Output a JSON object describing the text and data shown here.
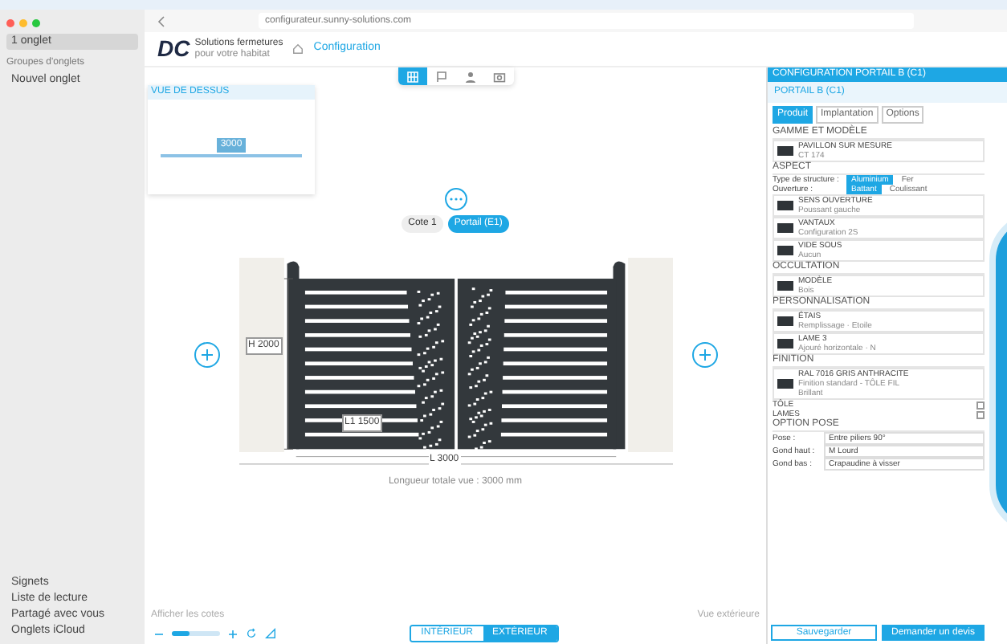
{
  "browser": {
    "url": "configurateur.sunny-solutions.com",
    "tabs": [
      {
        "label": "1 onglet",
        "selected": true
      }
    ],
    "group_heading": "Groupes d'onglets",
    "groups": [
      {
        "label": "Nouvel onglet"
      }
    ],
    "bottom_items": [
      {
        "label": "Signets"
      },
      {
        "label": "Liste de lecture"
      },
      {
        "label": "Partagé avec vous"
      },
      {
        "label": "Onglets iCloud"
      }
    ]
  },
  "header": {
    "logo": "DC",
    "brand_line1": "Solutions fermetures",
    "brand_line2": "pour votre habitat",
    "breadcrumb": "Configuration"
  },
  "view_tabs": [
    {
      "kind": "grid",
      "selected": true
    },
    {
      "kind": "plan",
      "selected": false
    },
    {
      "kind": "person",
      "selected": false
    },
    {
      "kind": "camera",
      "selected": false
    }
  ],
  "top_view": {
    "title": "VUE DE DESSUS",
    "width_label": "3000"
  },
  "scene": {
    "crumbs": [
      {
        "label": "Cote 1",
        "selected": false
      },
      {
        "label": "Portail (E1)",
        "selected": true
      }
    ],
    "height_label": "H 2000",
    "leaf_label": "L1 1500",
    "width_label": "L 3000",
    "total_label": "Longueur totale vue : 3000 mm"
  },
  "bottom_bar": {
    "left_hint": "Afficher les cotes",
    "right_hint": "Vue extérieure",
    "zoom": {
      "level": 0.35
    },
    "views": [
      {
        "label": "INTÉRIEUR",
        "selected": false
      },
      {
        "label": "EXTÉRIEUR",
        "selected": true
      }
    ]
  },
  "panel": {
    "title": "CONFIGURATION PORTAIL B (C1)",
    "subtitle": "PORTAIL B (C1)",
    "tabs": [
      {
        "label": "Produit",
        "selected": true
      },
      {
        "label": "Implantation",
        "selected": false
      },
      {
        "label": "Options",
        "selected": false
      }
    ],
    "sections": [
      {
        "title": "GAMME ET MODÈLE",
        "rows": [
          {
            "kind": "card",
            "name": "PAVILLON SUR MESURE",
            "detail": "CT 174"
          }
        ]
      },
      {
        "title": "ASPECT",
        "rows": [
          {
            "kind": "choice",
            "label": "Type de structure :",
            "options": [
              {
                "label": "Aluminium",
                "selected": true
              },
              {
                "label": "Fer",
                "selected": false
              }
            ]
          },
          {
            "kind": "choice",
            "label": "Ouverture :",
            "options": [
              {
                "label": "Battant",
                "selected": true
              },
              {
                "label": "Coulissant",
                "selected": false
              }
            ]
          },
          {
            "kind": "card",
            "name": "SENS OUVERTURE",
            "detail": "Poussant gauche"
          },
          {
            "kind": "card",
            "name": "VANTAUX",
            "detail": "Configuration 2S"
          },
          {
            "kind": "card",
            "name": "VIDE SOUS",
            "detail": "Aucun"
          }
        ]
      },
      {
        "title": "OCCULTATION",
        "rows": [
          {
            "kind": "card",
            "name": "MODÈLE",
            "detail": "Bois"
          }
        ]
      },
      {
        "title": "PERSONNALISATION",
        "rows": [
          {
            "kind": "card",
            "name": "ÉTAIS",
            "detail": "Remplissage · Etoile"
          },
          {
            "kind": "card",
            "name": "LAME 3",
            "detail": "Ajouré horizontale · N"
          }
        ]
      },
      {
        "title": "FINITION",
        "rows": [
          {
            "kind": "card",
            "name": "RAL 7016 GRIS ANTHRACITE",
            "detail": "Finition standard - TÔLE FIL",
            "extra": "Brillant"
          },
          {
            "kind": "check",
            "label": "TÔLE",
            "checked": false
          },
          {
            "kind": "check",
            "label": "LAMES",
            "checked": false
          }
        ]
      },
      {
        "title": "OPTION POSE",
        "rows": [
          {
            "kind": "select",
            "label": "Pose :",
            "value": "Entre piliers 90°"
          },
          {
            "kind": "select",
            "label": "Gond haut :",
            "value": "M Lourd"
          },
          {
            "kind": "select",
            "label": "Gond bas :",
            "value": "Crapaudine à visser"
          }
        ]
      }
    ],
    "buttons": [
      {
        "label": "Sauvegarder",
        "kind": "secondary"
      },
      {
        "label": "Demander un devis",
        "kind": "primary"
      }
    ]
  }
}
